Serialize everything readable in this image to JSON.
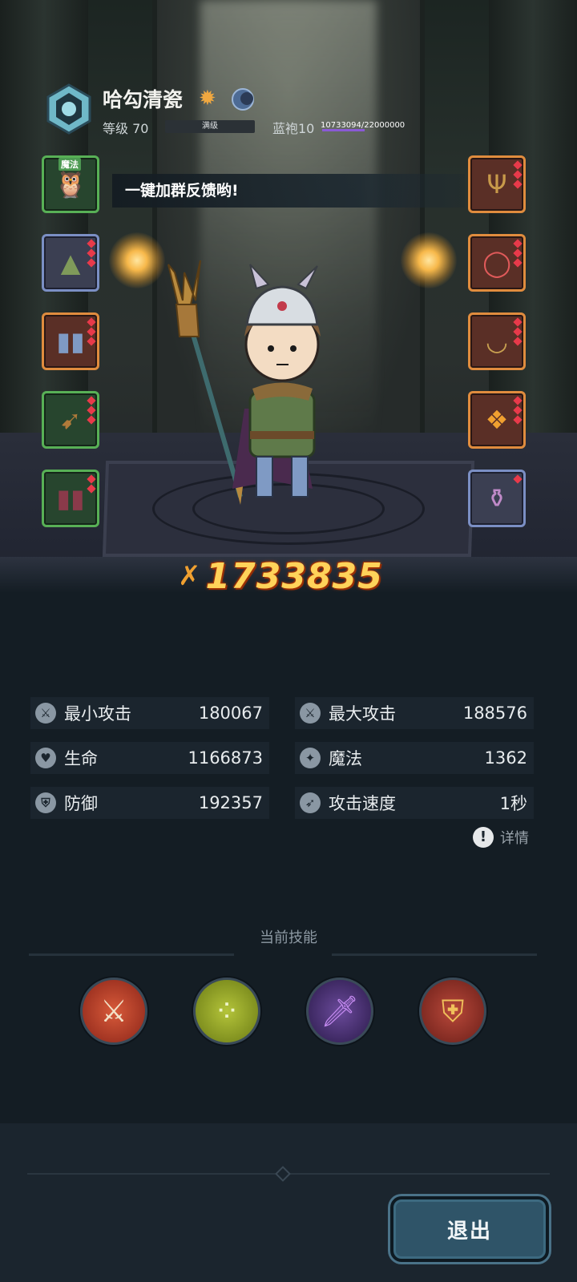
{
  "player": {
    "name": "哈勾清瓷",
    "level_label": "等级 70",
    "level_status": "满级",
    "rank_label": "蓝袍10",
    "rank_progress_text": "10733094/22000000",
    "rank_progress_fraction": 0.488
  },
  "speech": "一键加群反馈哟!",
  "pet_tag": "魔法",
  "combat_power": "1733835",
  "stats": [
    {
      "label": "最小攻击",
      "value": "180067",
      "icon": "sword-icon"
    },
    {
      "label": "最大攻击",
      "value": "188576",
      "icon": "sword-icon"
    },
    {
      "label": "生命",
      "value": "1166873",
      "icon": "heart-icon"
    },
    {
      "label": "魔法",
      "value": "1362",
      "icon": "magic-icon"
    },
    {
      "label": "防御",
      "value": "192357",
      "icon": "shield-icon"
    },
    {
      "label": "攻击速度",
      "value": "1秒",
      "icon": "speed-icon"
    }
  ],
  "detail_label": "详情",
  "skills_title": "当前技能",
  "skills": [
    "crossed-axes-skill-icon",
    "poison-bubbles-skill-icon",
    "purple-blade-skill-icon",
    "crown-shield-skill-icon"
  ],
  "exit_label": "退出",
  "colors": {
    "power": "#ffd35a",
    "rank_bar": "#8a5ad6",
    "button": "#2f5468",
    "slot_orange": "#e08c3e",
    "slot_green": "#58b056",
    "slot_blue": "#7b8fc4"
  }
}
